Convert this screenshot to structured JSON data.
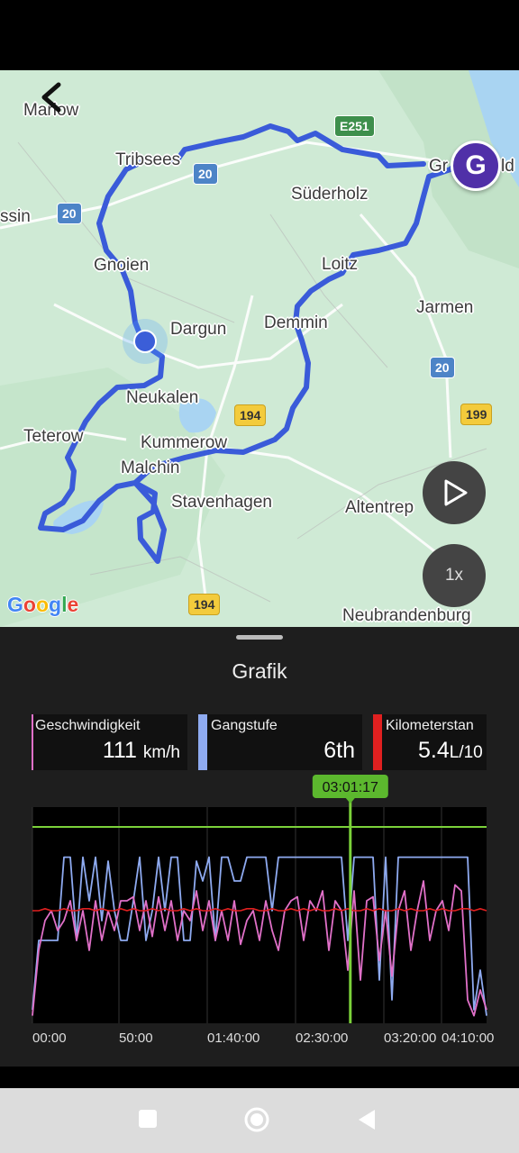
{
  "map": {
    "place_labels": [
      {
        "text": "Marlow"
      },
      {
        "text": "Tribsees"
      },
      {
        "text": "Süderholz"
      },
      {
        "text": "ssin"
      },
      {
        "text": "Gnoien"
      },
      {
        "text": "Loitz"
      },
      {
        "text": "Jarmen"
      },
      {
        "text": "Dargun"
      },
      {
        "text": "Demmin"
      },
      {
        "text": "Neukalen"
      },
      {
        "text": "Teterow"
      },
      {
        "text": "Kummerow"
      },
      {
        "text": "Malchin"
      },
      {
        "text": "Stavenhagen"
      },
      {
        "text": "Altentrep"
      },
      {
        "text": "Neubrandenburg"
      },
      {
        "text": "Gr"
      },
      {
        "text": "ld"
      }
    ],
    "road_shields": [
      {
        "text": "E251",
        "style": "green"
      },
      {
        "text": "20",
        "style": "blue"
      },
      {
        "text": "20",
        "style": "blue"
      },
      {
        "text": "20",
        "style": "blue"
      },
      {
        "text": "194",
        "style": "yellow"
      },
      {
        "text": "199",
        "style": "yellow"
      },
      {
        "text": "194",
        "style": "yellow"
      }
    ],
    "goal_marker": "G",
    "speed_label": "1x",
    "google_logo": "Google",
    "route_color": "#3a5bd9"
  },
  "panel": {
    "title": "Grafik",
    "metrics": [
      {
        "label": "Geschwindigkeit",
        "value": "111",
        "unit": "km/h",
        "color": "#e070c8"
      },
      {
        "label": "Gangstufe",
        "value": "6th",
        "unit": "",
        "color": "#8eaaf0"
      },
      {
        "label": "Kilometerstan",
        "value": "5.4",
        "unit": "L/10",
        "color": "#e02020"
      }
    ]
  },
  "chart_data": {
    "type": "line",
    "x_tick_labels": [
      "00:00",
      "50:00",
      "01:40:00",
      "02:30:00",
      "03:20:00",
      "04:10:00"
    ],
    "cursor_label": "03:01:17",
    "cursor_position": 0.7,
    "grid": true,
    "colors": {
      "speed": "#e070c8",
      "gear": "#8eaaf0",
      "consumption": "#e02020",
      "cursor": "#7bd13a"
    },
    "series": [
      {
        "key": "gear",
        "values": [
          0.05,
          0.4,
          0.4,
          0.4,
          0.4,
          0.82,
          0.82,
          0.4,
          0.82,
          0.6,
          0.82,
          0.5,
          0.8,
          0.55,
          0.4,
          0.4,
          0.6,
          0.82,
          0.4,
          0.55,
          0.82,
          0.55,
          0.82,
          0.82,
          0.4,
          0.4,
          0.8,
          0.7,
          0.82,
          0.4,
          0.82,
          0.82,
          0.7,
          0.7,
          0.82,
          0.82,
          0.82,
          0.82,
          0.55,
          0.82,
          0.82,
          0.82,
          0.82,
          0.82,
          0.82,
          0.82,
          0.82,
          0.82,
          0.82,
          0.82,
          0.4,
          0.82,
          0.82,
          0.82,
          0.82,
          0.2,
          0.82,
          0.1,
          0.82,
          0.82,
          0.82,
          0.82,
          0.82,
          0.82,
          0.82,
          0.82,
          0.82,
          0.82,
          0.82,
          0.82,
          0.05,
          0.25,
          0.02
        ]
      },
      {
        "key": "speed",
        "values": [
          0.02,
          0.35,
          0.5,
          0.55,
          0.45,
          0.5,
          0.6,
          0.4,
          0.55,
          0.35,
          0.6,
          0.4,
          0.55,
          0.45,
          0.6,
          0.6,
          0.62,
          0.45,
          0.6,
          0.42,
          0.62,
          0.45,
          0.6,
          0.4,
          0.55,
          0.5,
          0.65,
          0.45,
          0.6,
          0.4,
          0.55,
          0.4,
          0.6,
          0.38,
          0.5,
          0.55,
          0.4,
          0.6,
          0.45,
          0.35,
          0.55,
          0.6,
          0.62,
          0.4,
          0.6,
          0.55,
          0.65,
          0.35,
          0.6,
          0.55,
          0.25,
          0.65,
          0.2,
          0.6,
          0.62,
          0.3,
          0.55,
          0.22,
          0.55,
          0.65,
          0.35,
          0.55,
          0.7,
          0.4,
          0.55,
          0.6,
          0.45,
          0.68,
          0.65,
          0.1,
          0.02,
          0.15,
          0.05
        ]
      },
      {
        "key": "consumption",
        "values": [
          0.55,
          0.55,
          0.56,
          0.55,
          0.55,
          0.56,
          0.55,
          0.55,
          0.56,
          0.56,
          0.55,
          0.56,
          0.55,
          0.55,
          0.56,
          0.55,
          0.56,
          0.55,
          0.55,
          0.56,
          0.55,
          0.56,
          0.55,
          0.55,
          0.56,
          0.55,
          0.56,
          0.55,
          0.55,
          0.56,
          0.55,
          0.56,
          0.55,
          0.55,
          0.56,
          0.56,
          0.55,
          0.55,
          0.56,
          0.55,
          0.55,
          0.56,
          0.55,
          0.56,
          0.55,
          0.56,
          0.55,
          0.55,
          0.56,
          0.55,
          0.56,
          0.55,
          0.55,
          0.56,
          0.55,
          0.56,
          0.55,
          0.55,
          0.56,
          0.55,
          0.56,
          0.55,
          0.55,
          0.56,
          0.55,
          0.56,
          0.55,
          0.55,
          0.56,
          0.56,
          0.55,
          0.56,
          0.55
        ]
      }
    ]
  }
}
